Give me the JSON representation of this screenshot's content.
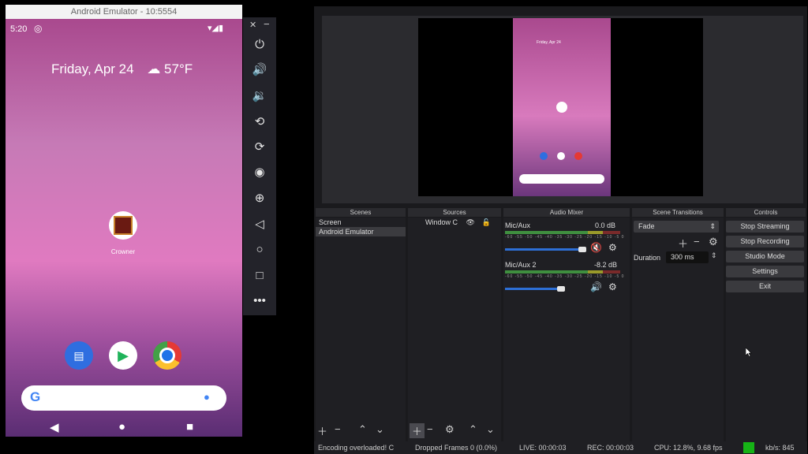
{
  "emulator": {
    "title": "Android Emulator - 10:5554",
    "status_time": "5:20",
    "date": "Friday, Apr 24",
    "weather": "57°F",
    "app_label": "Crowner",
    "search_logo": "G",
    "icons": [
      "power-icon",
      "volume-up-icon",
      "volume-down-icon",
      "rotate-left-icon",
      "rotate-right-icon",
      "camera-icon",
      "zoom-icon",
      "back-icon",
      "home-icon",
      "overview-icon",
      "more-icon"
    ]
  },
  "obs": {
    "docks": {
      "scenes": "Scenes",
      "sources": "Sources",
      "mixer": "Audio Mixer",
      "transitions": "Scene Transitions",
      "controls": "Controls"
    },
    "scenes": [
      "Screen",
      "Android Emulator"
    ],
    "sources": [
      "Window C"
    ],
    "mixer": [
      {
        "name": "Mic/Aux",
        "db": "0.0 dB"
      },
      {
        "name": "Mic/Aux 2",
        "db": "-8.2 dB"
      }
    ],
    "meter_ticks": "-60 -55 -50 -45 -40 -35 -30 -25 -20 -15 -10 -5 0",
    "transition": {
      "selected": "Fade",
      "duration_label": "Duration",
      "duration_value": "300 ms"
    },
    "controls": [
      "Stop Streaming",
      "Stop Recording",
      "Studio Mode",
      "Settings",
      "Exit"
    ],
    "status": {
      "encoding": "Encoding overloaded! C",
      "dropped": "Dropped Frames 0 (0.0%)",
      "live": "LIVE: 00:00:03",
      "rec": "REC: 00:00:03",
      "cpu": "CPU: 12.8%, 9.68 fps",
      "kbps": "kb/s: 845"
    },
    "accent": "#16b316",
    "slider_blue": "#2d6fd6"
  }
}
